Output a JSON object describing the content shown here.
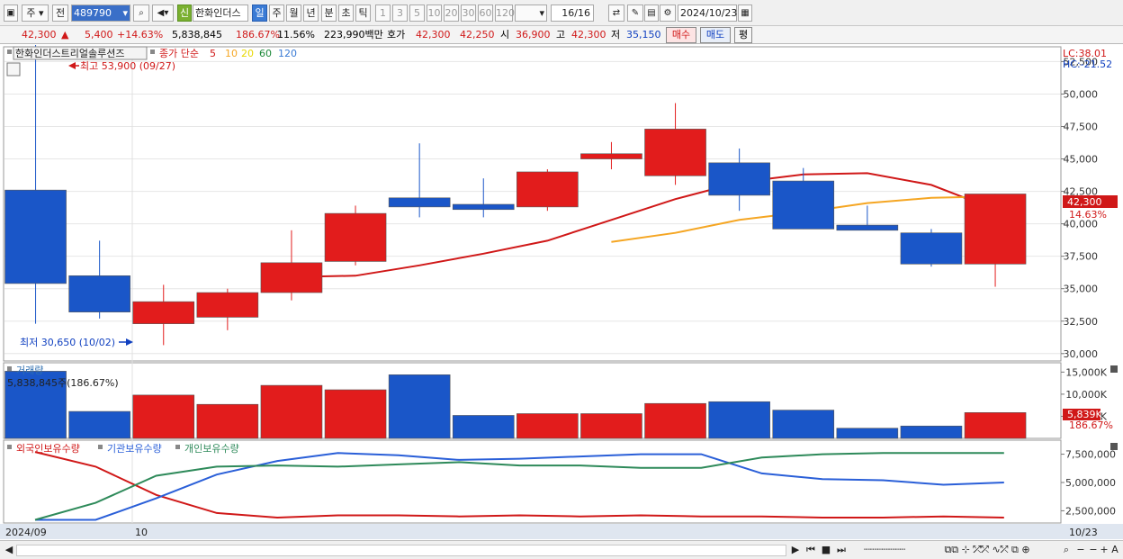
{
  "toolbar": {
    "period_label": "주",
    "prev_label": "전",
    "code": "489790",
    "new_badge": "신",
    "stock_name": "한화인더스",
    "periods": [
      "일",
      "주",
      "월",
      "년",
      "분",
      "초",
      "틱"
    ],
    "intervals": [
      "1",
      "3",
      "5",
      "10",
      "20",
      "30",
      "60",
      "120"
    ],
    "page_counter": "16/16",
    "date": "2024/10/23"
  },
  "quote": {
    "price": "42,300",
    "change": "5,400",
    "change_pct": "+14.63%",
    "volume": "5,838,845",
    "volume_ratio": "186.67%",
    "turnover": "11.56%",
    "amount": "223,990백만",
    "ask_label": "호가",
    "ask": "42,300",
    "bid": "42,250",
    "open_label": "시",
    "open": "36,900",
    "high_label": "고",
    "high": "42,300",
    "low_label": "저",
    "low": "35,150",
    "buy_label": "매수",
    "sell_label": "매도",
    "eval_label": "평"
  },
  "price_panel": {
    "title": "한화인더스트리얼솔루션즈",
    "ma_label": "종가 단순",
    "ma_periods": [
      "5",
      "10",
      "20",
      "60",
      "120"
    ],
    "ma_colors": [
      "#d01818",
      "#f5a623",
      "#e8d800",
      "#1e8a3a",
      "#3a7bd5"
    ],
    "max_label": "최고 53,900 (09/27)",
    "min_label": "최저 30,650 (10/02)",
    "lc": "LC:38.01",
    "hc": "HC:-21.52",
    "last_price_tag": "42,300",
    "last_pct_tag": "14.63%",
    "y_ticks": [
      "52,500",
      "50,000",
      "47,500",
      "45,000",
      "42,500",
      "40,000",
      "37,500",
      "35,000",
      "32,500",
      "30,000"
    ]
  },
  "volume_panel": {
    "title": "거래량",
    "info": "5,838,845주(186.67%)",
    "y_ticks": [
      "15,000K",
      "10,000K",
      "5,000K"
    ],
    "last_tag": "5,839K",
    "last_pct": "186.67%"
  },
  "holding_panel": {
    "series": [
      "외국인보유수량",
      "기관보유수량",
      "개인보유수량"
    ],
    "colors": [
      "#d01818",
      "#2a5fd8",
      "#2e8a5a"
    ],
    "y_ticks": [
      "7,500,000",
      "5,000,000",
      "2,500,000"
    ]
  },
  "axis": {
    "labels": [
      "2024/09",
      "10"
    ],
    "right_label": "10/23"
  },
  "chart_data": [
    {
      "type": "candlestick",
      "title": "한화인더스트리얼솔루션즈",
      "ylim": [
        29500,
        53500
      ],
      "candles": [
        {
          "open": 42600,
          "high": 53900,
          "low": 32300,
          "close": 35400
        },
        {
          "open": 36000,
          "high": 38700,
          "low": 32700,
          "close": 33200
        },
        {
          "open": 32300,
          "high": 35300,
          "low": 30650,
          "close": 34000
        },
        {
          "open": 32800,
          "high": 35000,
          "low": 31800,
          "close": 34700
        },
        {
          "open": 34700,
          "high": 39500,
          "low": 34100,
          "close": 37000
        },
        {
          "open": 37100,
          "high": 41400,
          "low": 36800,
          "close": 40800
        },
        {
          "open": 42000,
          "high": 46200,
          "low": 40500,
          "close": 41300
        },
        {
          "open": 41500,
          "high": 43500,
          "low": 40500,
          "close": 41100
        },
        {
          "open": 41300,
          "high": 44200,
          "low": 41000,
          "close": 44000
        },
        {
          "open": 45000,
          "high": 46300,
          "low": 44200,
          "close": 45400
        },
        {
          "open": 43700,
          "high": 49300,
          "low": 43000,
          "close": 47300
        },
        {
          "open": 44700,
          "high": 45800,
          "low": 41000,
          "close": 42200
        },
        {
          "open": 43300,
          "high": 44300,
          "low": 39600,
          "close": 39600
        },
        {
          "open": 39900,
          "high": 41400,
          "low": 39500,
          "close": 39500
        },
        {
          "open": 39300,
          "high": 39600,
          "low": 36700,
          "close": 36900
        },
        {
          "open": 36900,
          "high": 42300,
          "low": 35150,
          "close": 42300
        }
      ],
      "ma5": [
        null,
        null,
        null,
        null,
        35900,
        36000,
        36800,
        37700,
        38700,
        40300,
        41900,
        43200,
        43800,
        43900,
        43000,
        41100,
        40300
      ],
      "ma10": [
        null,
        null,
        null,
        null,
        null,
        null,
        null,
        null,
        null,
        38600,
        39300,
        40300,
        40900,
        41600,
        42000,
        42100
      ],
      "volume_unit": "K",
      "volume": [
        15200,
        6100,
        9800,
        7700,
        12000,
        11000,
        14400,
        5200,
        5600,
        5600,
        7900,
        8300,
        6400,
        2300,
        2800,
        5839
      ]
    },
    {
      "type": "line",
      "series": [
        {
          "name": "외국인보유수량",
          "values": [
            7700000,
            6400000,
            3900000,
            2300000,
            1900000,
            2100000,
            2100000,
            2000000,
            2100000,
            2000000,
            2100000,
            2000000,
            2000000,
            1900000,
            1900000,
            2000000,
            1900000
          ]
        },
        {
          "name": "기관보유수량",
          "values": [
            1700000,
            1700000,
            3600000,
            5700000,
            6900000,
            7600000,
            7400000,
            7000000,
            7100000,
            7300000,
            7500000,
            7500000,
            5800000,
            5300000,
            5200000,
            4800000,
            5000000
          ]
        },
        {
          "name": "개인보유수량",
          "values": [
            1700000,
            3200000,
            5600000,
            6400000,
            6500000,
            6400000,
            6600000,
            6800000,
            6500000,
            6500000,
            6300000,
            6300000,
            7200000,
            7500000,
            7600000,
            7600000,
            7600000
          ]
        }
      ],
      "ylim": [
        1500000,
        8500000
      ]
    }
  ]
}
